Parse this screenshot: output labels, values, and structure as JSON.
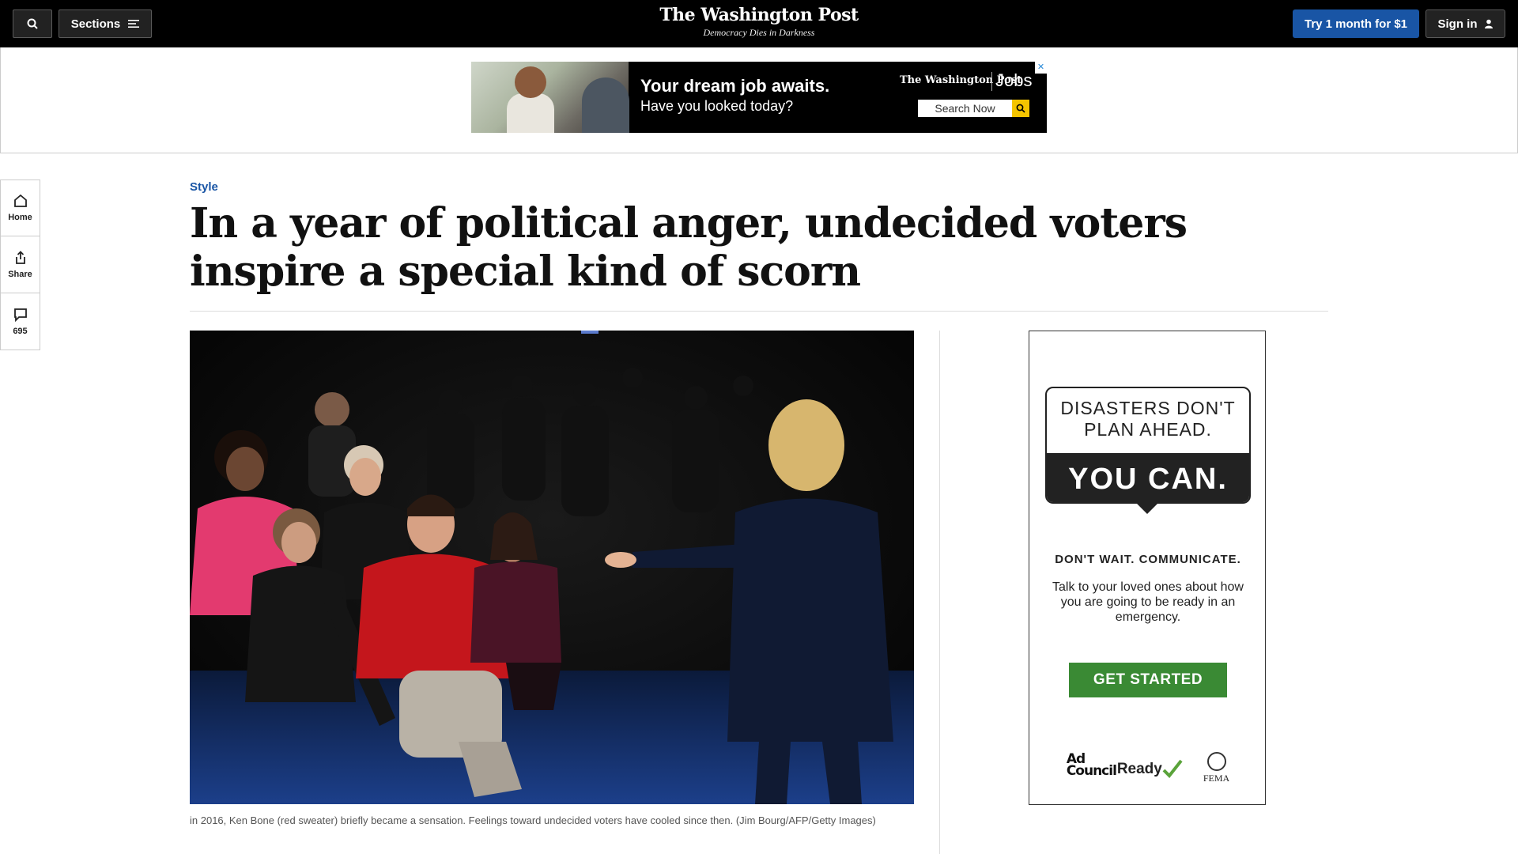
{
  "header": {
    "sections_label": "Sections",
    "logo": "The Washington Post",
    "tagline": "Democracy Dies in Darkness",
    "trial_label": "Try 1 month for $1",
    "signin_label": "Sign in"
  },
  "top_ad": {
    "headline": "Your dream job awaits.",
    "subline": "Have you looked today?",
    "brand": "The Washington Post",
    "product": "Jobs",
    "search_label": "Search Now"
  },
  "rail": {
    "home_label": "Home",
    "share_label": "Share",
    "comments_count": "695"
  },
  "article": {
    "kicker": "Style",
    "headline": "In a year of political anger, undecided voters inspire a special kind of scorn",
    "caption": "in 2016, Ken Bone (red sweater) briefly became a sensation. Feelings toward undecided voters have cooled since then. (Jim Bourg/AFP/Getty Images)"
  },
  "side_ad": {
    "line1": "DISASTERS DON'T",
    "line2": "PLAN AHEAD.",
    "line3": "YOU CAN.",
    "subhead": "DON'T WAIT. COMMUNICATE.",
    "body": "Talk to your loved ones about how you are going to be ready in an emergency.",
    "cta": "GET STARTED",
    "logo1": "Ad Council",
    "logo2": "Ready",
    "logo3": "FEMA"
  },
  "colors": {
    "accent_blue": "#1955a5",
    "cta_green": "#3a8a34"
  }
}
